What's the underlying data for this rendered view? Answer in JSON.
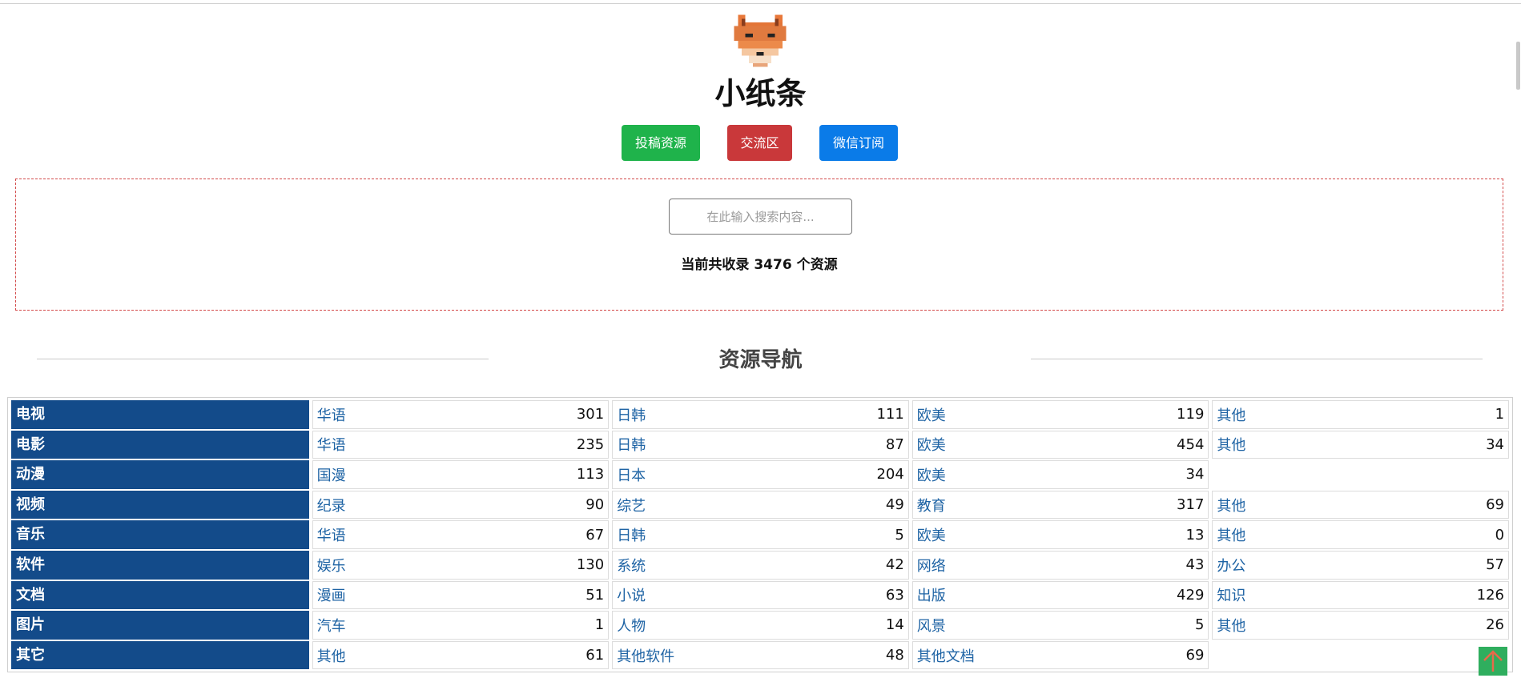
{
  "site": {
    "title": "小纸条",
    "logo_icon": "fox-icon"
  },
  "header_buttons": {
    "submit_label": "投稿资源",
    "forum_label": "交流区",
    "wechat_label": "微信订阅",
    "colors": {
      "submit": "#1fb34b",
      "forum": "#c9383a",
      "wechat": "#0a7be8"
    }
  },
  "search": {
    "placeholder": "在此输入搜索内容...",
    "value": "",
    "count_text": "当前共收录 3476 个资源"
  },
  "nav": {
    "heading": "资源导航",
    "accent_color": "#134b8a",
    "rows": [
      {
        "category": "电视",
        "items": [
          {
            "label": "华语",
            "count": "301"
          },
          {
            "label": "日韩",
            "count": "111"
          },
          {
            "label": "欧美",
            "count": "119"
          },
          {
            "label": "其他",
            "count": "1"
          }
        ]
      },
      {
        "category": "电影",
        "items": [
          {
            "label": "华语",
            "count": "235"
          },
          {
            "label": "日韩",
            "count": "87"
          },
          {
            "label": "欧美",
            "count": "454"
          },
          {
            "label": "其他",
            "count": "34"
          }
        ]
      },
      {
        "category": "动漫",
        "items": [
          {
            "label": "国漫",
            "count": "113"
          },
          {
            "label": "日本",
            "count": "204"
          },
          {
            "label": "欧美",
            "count": "34"
          }
        ]
      },
      {
        "category": "视频",
        "items": [
          {
            "label": "纪录",
            "count": "90"
          },
          {
            "label": "综艺",
            "count": "49"
          },
          {
            "label": "教育",
            "count": "317"
          },
          {
            "label": "其他",
            "count": "69"
          }
        ]
      },
      {
        "category": "音乐",
        "items": [
          {
            "label": "华语",
            "count": "67"
          },
          {
            "label": "日韩",
            "count": "5"
          },
          {
            "label": "欧美",
            "count": "13"
          },
          {
            "label": "其他",
            "count": "0"
          }
        ]
      },
      {
        "category": "软件",
        "items": [
          {
            "label": "娱乐",
            "count": "130"
          },
          {
            "label": "系统",
            "count": "42"
          },
          {
            "label": "网络",
            "count": "43"
          },
          {
            "label": "办公",
            "count": "57"
          }
        ]
      },
      {
        "category": "文档",
        "items": [
          {
            "label": "漫画",
            "count": "51"
          },
          {
            "label": "小说",
            "count": "63"
          },
          {
            "label": "出版",
            "count": "429"
          },
          {
            "label": "知识",
            "count": "126"
          }
        ]
      },
      {
        "category": "图片",
        "items": [
          {
            "label": "汽车",
            "count": "1"
          },
          {
            "label": "人物",
            "count": "14"
          },
          {
            "label": "风景",
            "count": "5"
          },
          {
            "label": "其他",
            "count": "26"
          }
        ]
      },
      {
        "category": "其它",
        "items": [
          {
            "label": "其他",
            "count": "61"
          },
          {
            "label": "其他软件",
            "count": "48"
          },
          {
            "label": "其他文档",
            "count": "69"
          }
        ]
      }
    ]
  },
  "back_to_top_icon": "arrow-up-icon"
}
